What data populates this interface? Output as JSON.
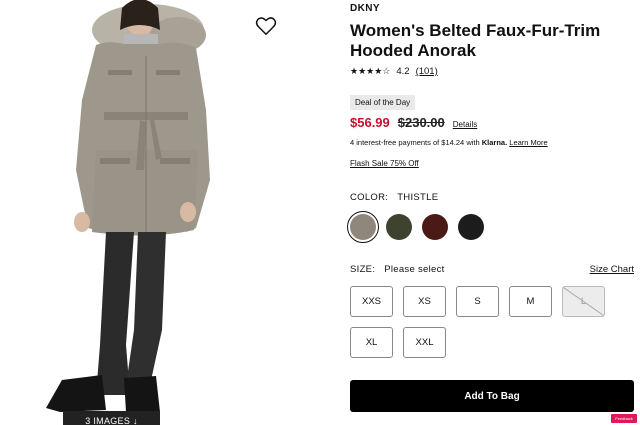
{
  "product": {
    "brand": "DKNY",
    "title": "Women's Belted Faux-Fur-Trim Hooded Anorak",
    "stars": "★★★★☆",
    "rating_value": "4.2",
    "rating_count": "(101)",
    "deal_badge": "Deal of the Day",
    "sale_price": "$56.99",
    "original_price": "$230.00",
    "details_link": "Details",
    "klarna_text": "4 interest-free payments of $14.24 with",
    "klarna_brand": "Klarna.",
    "klarna_learn": "Learn More",
    "flash_sale": "Flash Sale 75% Off"
  },
  "gallery": {
    "images_button": "3 IMAGES ↓",
    "wishlist_icon": "heart-icon"
  },
  "color": {
    "label": "COLOR:",
    "selected": "THISTLE",
    "swatches": [
      {
        "name": "thistle",
        "hex": "#8f877c"
      },
      {
        "name": "olive",
        "hex": "#3e4330"
      },
      {
        "name": "burgundy",
        "hex": "#4a1a17"
      },
      {
        "name": "black",
        "hex": "#1c1c1c"
      }
    ]
  },
  "size": {
    "label": "SIZE:",
    "prompt": "Please select",
    "chart_link": "Size Chart",
    "options": [
      "XXS",
      "XS",
      "S",
      "M",
      "L",
      "XL",
      "XXL"
    ],
    "unavailable": [
      "L"
    ]
  },
  "cart": {
    "add_label": "Add To Bag"
  },
  "feedback": {
    "label": "Feedback"
  }
}
